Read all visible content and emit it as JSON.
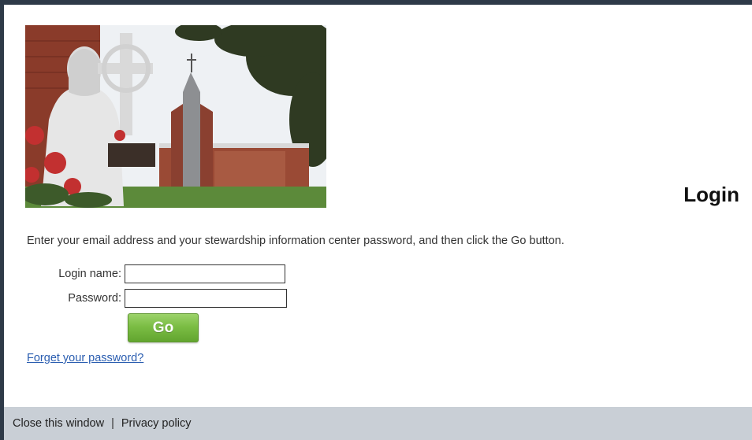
{
  "page": {
    "title": "Login",
    "instructions": "Enter your email address and your stewardship information center password, and then click the Go button."
  },
  "form": {
    "login_label": "Login name:",
    "login_value": "",
    "password_label": "Password:",
    "password_value": "",
    "go_label": "Go"
  },
  "links": {
    "forgot": "Forget your password?"
  },
  "footer": {
    "close_label": "Close this window",
    "separator": "|",
    "privacy_label": "Privacy policy"
  },
  "colors": {
    "go_button": "#7bbd44",
    "footer_bg": "#c9cfd6",
    "link": "#2a5db0",
    "frame": "#2e3a48"
  }
}
